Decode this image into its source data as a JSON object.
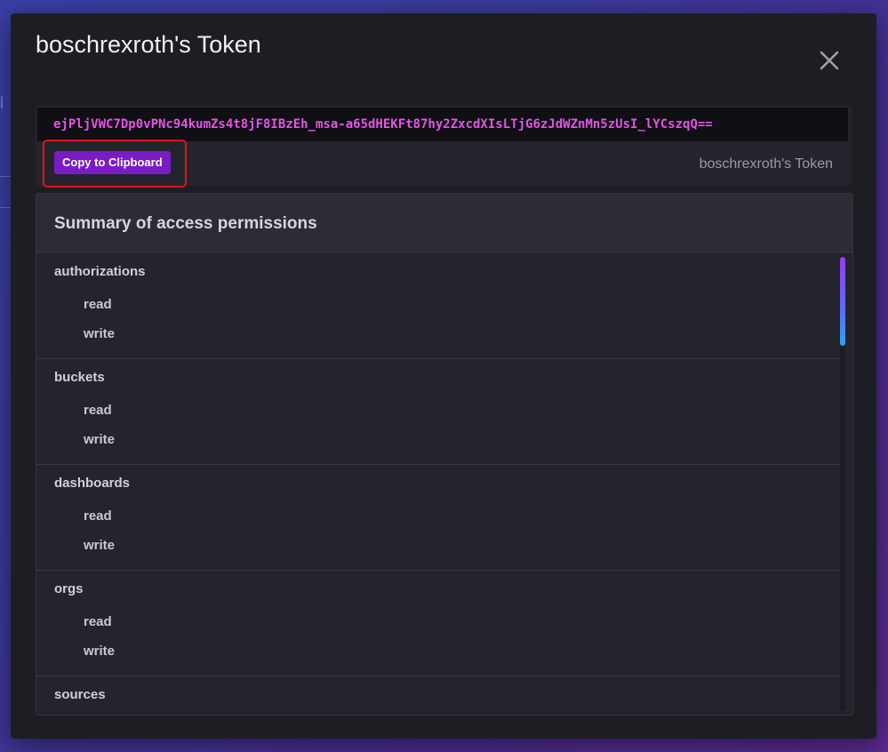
{
  "modal": {
    "title": "boschrexroth's Token",
    "close_icon": "close-icon"
  },
  "token": {
    "value": "ejPljVWC7Dp0vPNc94kumZs4t8jF8IBzEh_msa-a65dHEKFt87hy2ZxcdXIsLTjG6zJdWZnMn5zUsI_lYCszqQ==",
    "copy_label": "Copy to Clipboard",
    "label": "boschrexroth's Token"
  },
  "summary": {
    "title": "Summary of access permissions",
    "groups": [
      {
        "resource": "authorizations",
        "actions": [
          "read",
          "write"
        ]
      },
      {
        "resource": "buckets",
        "actions": [
          "read",
          "write"
        ]
      },
      {
        "resource": "dashboards",
        "actions": [
          "read",
          "write"
        ]
      },
      {
        "resource": "orgs",
        "actions": [
          "read",
          "write"
        ]
      },
      {
        "resource": "sources",
        "actions": []
      }
    ]
  },
  "colors": {
    "accent": "#7a1cc6",
    "token_text": "#e355e6",
    "highlight": "#e3101e"
  }
}
